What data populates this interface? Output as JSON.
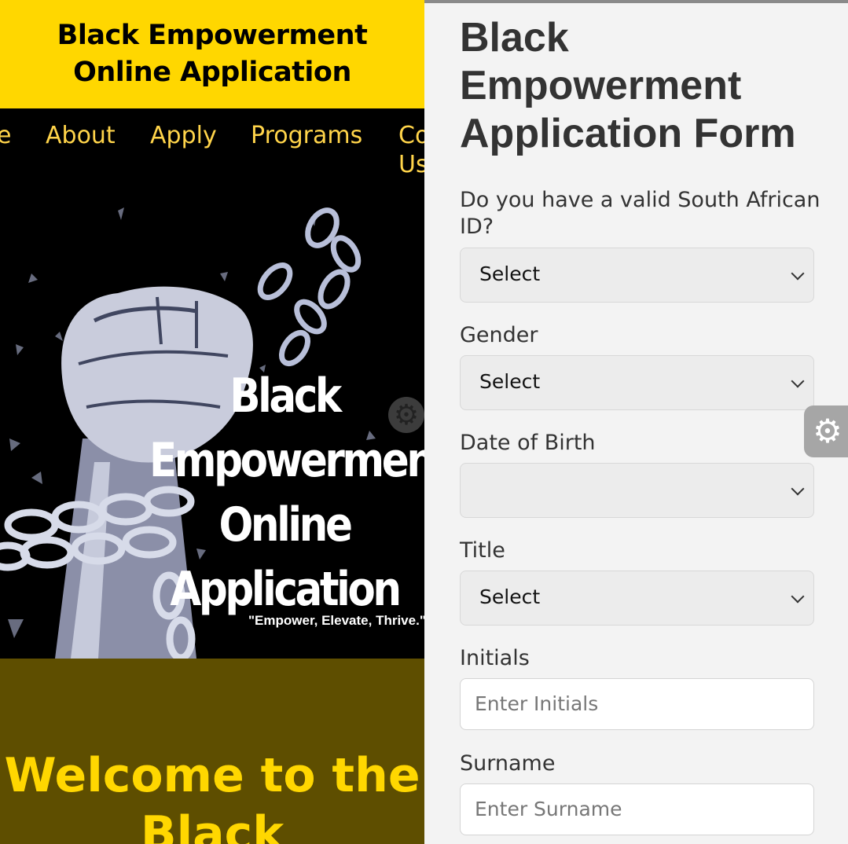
{
  "site": {
    "header_title": "Black Empowerment Online Application",
    "nav": [
      "e",
      "About",
      "Apply",
      "Programs",
      "Co",
      "Us"
    ],
    "hero_title": [
      "Black",
      "Empowerment",
      "Online",
      "Application"
    ],
    "hero_tagline": "\"Empower, Elevate, Thrive.\"",
    "welcome": [
      "Welcome to the",
      "Black"
    ]
  },
  "form": {
    "title": "Black Empowerment Application Form",
    "fields": {
      "sa_id": {
        "label": "Do you have a valid South African ID?",
        "value": "Select"
      },
      "gender": {
        "label": "Gender",
        "value": "Select"
      },
      "dob": {
        "label": "Date of Birth",
        "value": ""
      },
      "title": {
        "label": "Title",
        "value": "Select"
      },
      "initials": {
        "label": "Initials",
        "placeholder": "Enter Initials"
      },
      "surname": {
        "label": "Surname",
        "placeholder": "Enter Surname"
      }
    }
  },
  "colors": {
    "header_yellow": "#ffd700",
    "nav_text": "#ffd44a",
    "welcome_bg": "#5e4e00"
  },
  "icons": {
    "floating": "gear-icon",
    "chevron": "chevron-down-icon"
  }
}
